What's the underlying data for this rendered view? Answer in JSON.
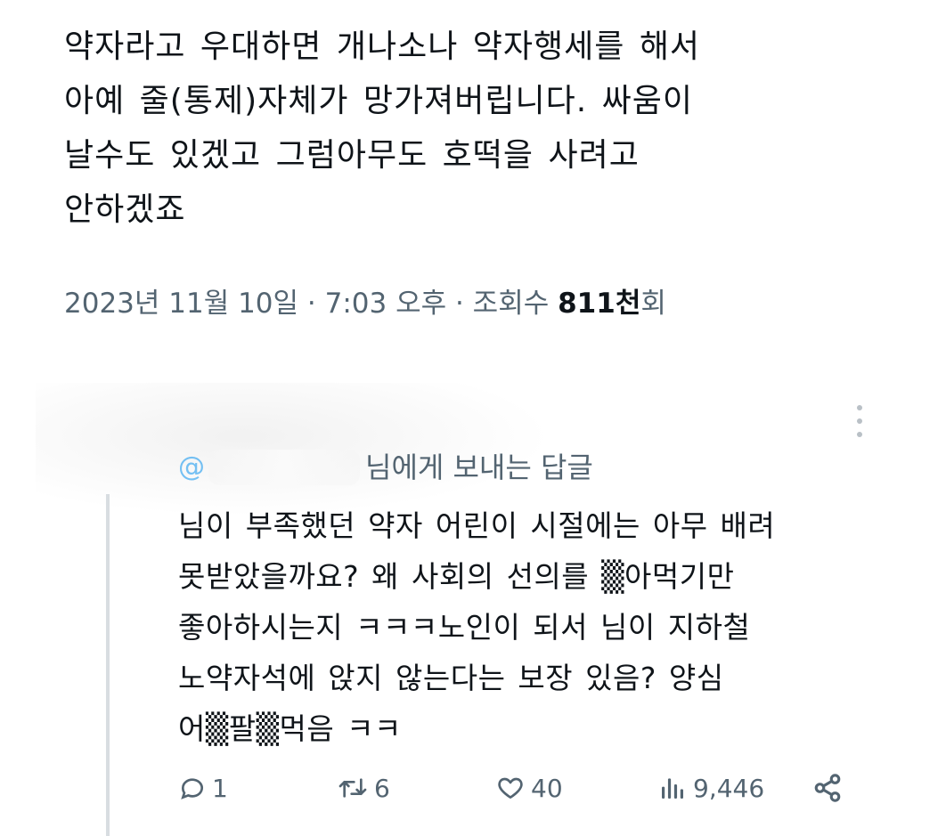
{
  "tweet": {
    "lines": [
      "약자라고 우대하면 개나소나 약자행세를 해서",
      "아예 줄(통제)자체가 망가져버립니다. 싸움이",
      "날수도 있겠고 그럼아무도 호떡을 사려고",
      "안하겠죠"
    ],
    "meta": {
      "datetime": "2023년 11월 10일 · 7:03 오후 · 조회수 ",
      "views_count": "811천",
      "views_suffix": "회"
    }
  },
  "reply": {
    "reply_to_at": "@",
    "reply_to_label": "님에게 보내는 답글",
    "lines": [
      "님이 부족했던 약자 어린이 시절에는 아무 배려",
      "못받았을까요? 왜 사회의 선의를 ▒아먹기만",
      "좋아하시는지 ㅋㅋㅋ노인이 되서 님이 지하철",
      "노약자석에 앉지 않는다는 보장 있음? 양심",
      "어▒팔▒먹음 ㅋㅋ"
    ],
    "actions": {
      "replies": "1",
      "retweets": "6",
      "likes": "40",
      "views": "9,446"
    }
  },
  "icons": {
    "reply": "comment-icon",
    "retweet": "retweet-icon",
    "like": "heart-icon",
    "views": "analytics-icon",
    "share": "share-icon",
    "more": "more-icon"
  },
  "colors": {
    "text": "#0f1419",
    "secondary": "#536471",
    "accent": "#1d9bf0",
    "thread_line": "#d8dde1"
  }
}
